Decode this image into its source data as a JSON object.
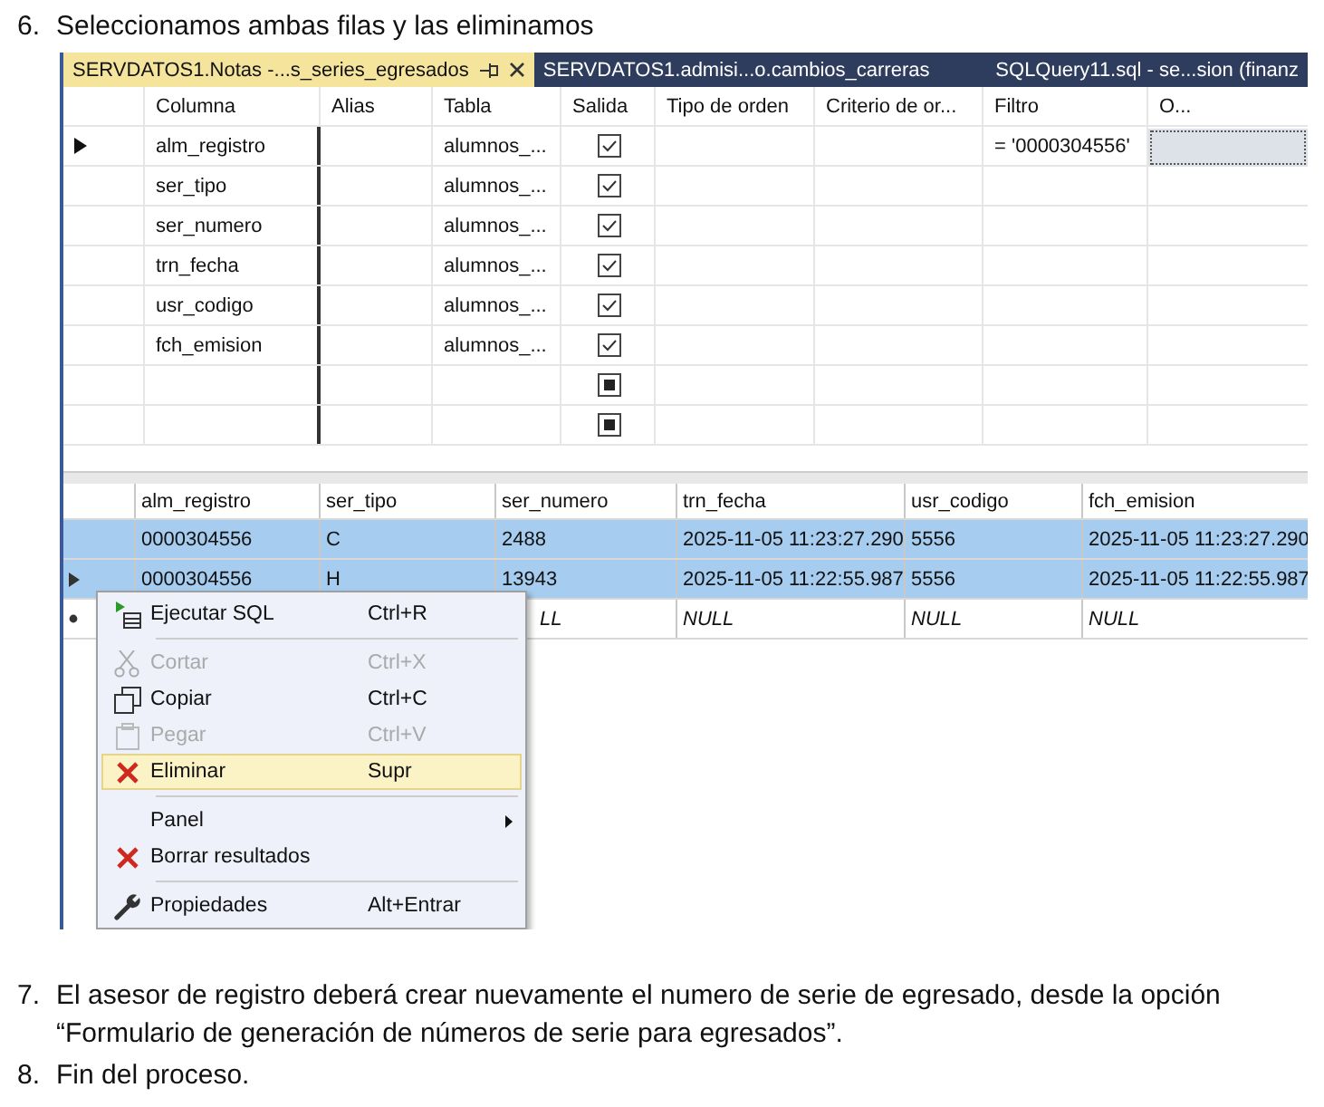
{
  "step_before": {
    "number": "6.",
    "text": "Seleccionamos ambas filas y las eliminamos"
  },
  "tabs": [
    {
      "label": "SERVDATOS1.Notas -...s_series_egresados",
      "selected": true,
      "pinned": true,
      "closable": true
    },
    {
      "label": "SERVDATOS1.admisi...o.cambios_carreras",
      "selected": false,
      "pinned": false,
      "closable": false
    },
    {
      "label": "SQLQuery11.sql - se...sion (finanz",
      "selected": false,
      "pinned": false,
      "closable": false
    }
  ],
  "design_grid": {
    "columns": [
      "Columna",
      "Alias",
      "Tabla",
      "Salida",
      "Tipo de orden",
      "Criterio de or...",
      "Filtro",
      "O..."
    ],
    "rows": [
      {
        "current": true,
        "column": "alm_registro",
        "table": "alumnos_...",
        "checked": true,
        "indeterminate": false,
        "filter": "= '0000304556'",
        "focused": true
      },
      {
        "current": false,
        "column": "ser_tipo",
        "table": "alumnos_...",
        "checked": true,
        "indeterminate": false,
        "focused": false
      },
      {
        "current": false,
        "column": "ser_numero",
        "table": "alumnos_...",
        "checked": true,
        "indeterminate": false,
        "focused": false
      },
      {
        "current": false,
        "column": "trn_fecha",
        "table": "alumnos_...",
        "checked": true,
        "indeterminate": false,
        "focused": false
      },
      {
        "current": false,
        "column": "usr_codigo",
        "table": "alumnos_...",
        "checked": true,
        "indeterminate": false,
        "focused": false
      },
      {
        "current": false,
        "column": "fch_emision",
        "table": "alumnos_...",
        "checked": true,
        "indeterminate": false,
        "focused": false
      },
      {
        "current": false,
        "indeterminate": true,
        "focused": false
      },
      {
        "current": false,
        "indeterminate": true,
        "focused": false
      }
    ]
  },
  "results_grid": {
    "columns": [
      "alm_registro",
      "ser_tipo",
      "ser_numero",
      "trn_fecha",
      "usr_codigo",
      "fch_emision"
    ],
    "rows": [
      {
        "current": false,
        "new_row": false,
        "selected": true,
        "cells": [
          {
            "text": "0000304556"
          },
          {
            "text": "C"
          },
          {
            "text": "2488"
          },
          {
            "text": "2025-11-05 11:23:27.290"
          },
          {
            "text": "5556"
          },
          {
            "text": "2025-11-05 11:23:27.290"
          }
        ]
      },
      {
        "current": true,
        "new_row": false,
        "selected": true,
        "cells": [
          {
            "text": "0000304556"
          },
          {
            "text": "H"
          },
          {
            "text": "13943"
          },
          {
            "text": "2025-11-05 11:22:55.987"
          },
          {
            "text": "5556"
          },
          {
            "text": "2025-11-05 11:22:55.987"
          }
        ]
      },
      {
        "current": false,
        "new_row": true,
        "selected": false,
        "cells": [
          null,
          null,
          {
            "text": "LL",
            "covered": true
          },
          {
            "text": "NULL"
          },
          {
            "text": "NULL"
          },
          {
            "text": "NULL"
          }
        ]
      }
    ]
  },
  "context_menu": [
    {
      "kind": "item",
      "label": "Ejecutar SQL",
      "shortcut": "Ctrl+R",
      "disabled": false,
      "highlighted": false,
      "submenu": false
    },
    {
      "kind": "separator"
    },
    {
      "kind": "item",
      "label": "Cortar",
      "shortcut": "Ctrl+X",
      "disabled": true,
      "highlighted": false,
      "submenu": false
    },
    {
      "kind": "item",
      "label": "Copiar",
      "shortcut": "Ctrl+C",
      "disabled": false,
      "highlighted": false,
      "submenu": false
    },
    {
      "kind": "item",
      "label": "Pegar",
      "shortcut": "Ctrl+V",
      "disabled": true,
      "highlighted": false,
      "submenu": false
    },
    {
      "kind": "item",
      "label": "Eliminar",
      "shortcut": "Supr",
      "disabled": false,
      "highlighted": true,
      "submenu": false
    },
    {
      "kind": "separator"
    },
    {
      "kind": "item",
      "label": "Panel",
      "disabled": false,
      "highlighted": false,
      "submenu": true
    },
    {
      "kind": "item",
      "label": "Borrar resultados",
      "disabled": false,
      "highlighted": false,
      "submenu": false
    },
    {
      "kind": "separator"
    },
    {
      "kind": "item",
      "label": "Propiedades",
      "shortcut": "Alt+Entrar",
      "disabled": false,
      "highlighted": false,
      "submenu": false
    }
  ],
  "steps_after": [
    {
      "number": "7.",
      "text": "El asesor de registro deberá crear nuevamente el numero de serie de egresado, desde la opción “Formulario de generación de números de serie para egresados”."
    },
    {
      "number": "8.",
      "text": "Fin del proceso."
    }
  ]
}
